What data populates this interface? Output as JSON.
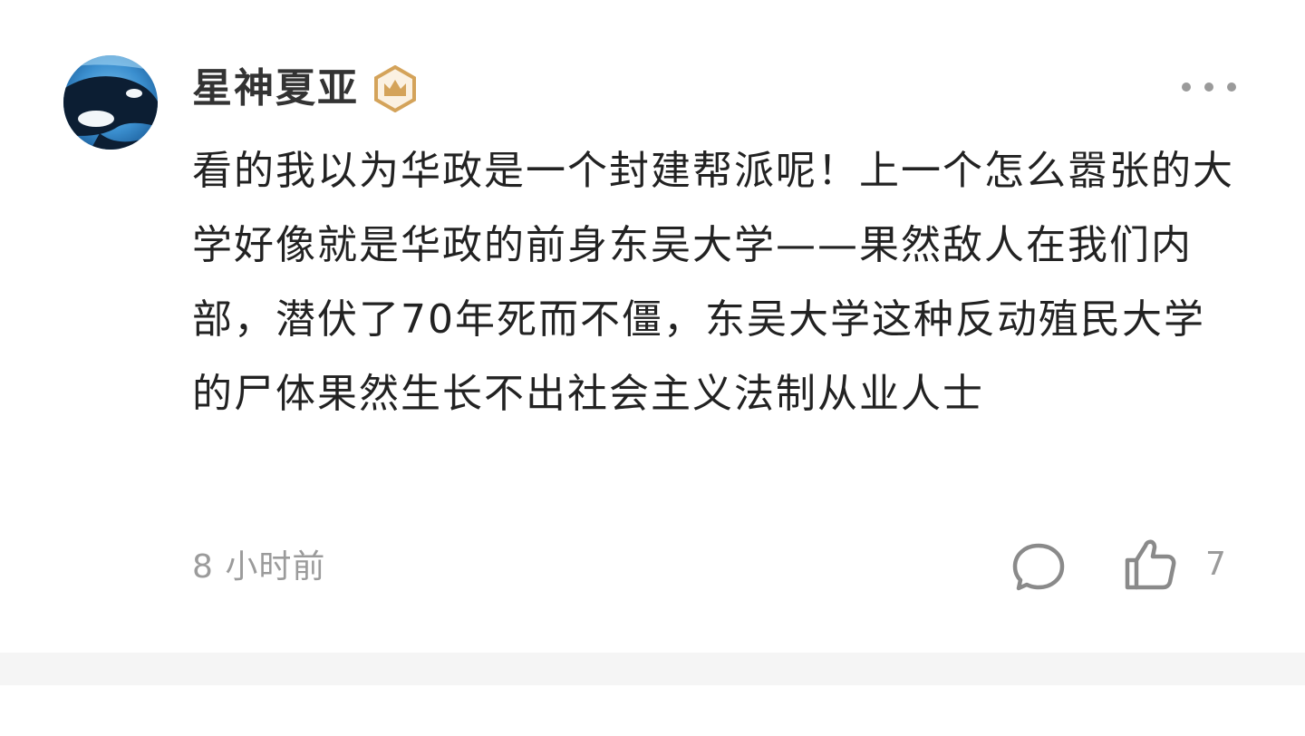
{
  "comment": {
    "author": {
      "name": "星神夏亚",
      "avatar_icon": "orca-avatar",
      "badge_icon": "crown-badge-icon",
      "badge_color": "#d4a35a"
    },
    "body": "看的我以为华政是一个封建帮派呢！上一个怎么嚣张的大学好像就是华政的前身东吴大学——果然敌人在我们内部，潜伏了70年死而不僵，东吴大学这种反动殖民大学的尸体果然生长不出社会主义法制从业人士",
    "timestamp": "8 小时前",
    "reply_icon": "comment-bubble-icon",
    "like_icon": "thumbs-up-icon",
    "like_count": "7",
    "more_icon": "more-dots-icon"
  },
  "colors": {
    "text_primary": "#222222",
    "text_secondary": "#9b9b9b",
    "separator": "#f5f5f5"
  }
}
